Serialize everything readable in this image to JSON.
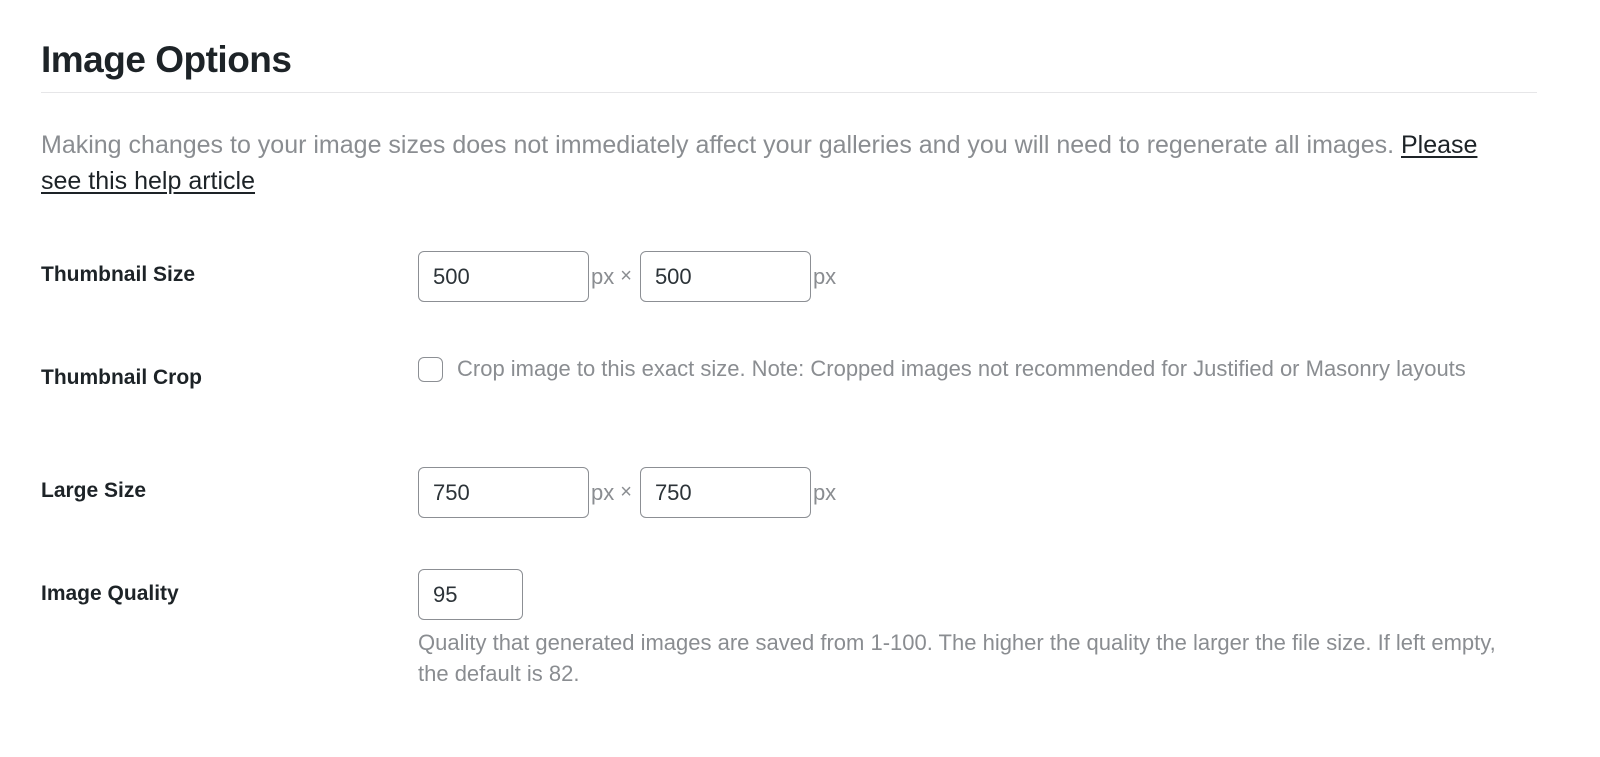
{
  "section": {
    "title": "Image Options",
    "intro_text": "Making changes to your image sizes does not immediately affect your galleries and you will need to regenerate all images. ",
    "help_link_label": "Please see this help article"
  },
  "fields": {
    "thumbnail_size": {
      "label": "Thumbnail Size",
      "width_value": "500",
      "height_value": "500",
      "unit": "px",
      "separator": "×"
    },
    "thumbnail_crop": {
      "label": "Thumbnail Crop",
      "checked": false,
      "description": "Crop image to this exact size. Note: Cropped images not recommended for Justified or Masonry layouts"
    },
    "large_size": {
      "label": "Large Size",
      "width_value": "750",
      "height_value": "750",
      "unit": "px",
      "separator": "×"
    },
    "image_quality": {
      "label": "Image Quality",
      "value": "95",
      "description": "Quality that generated images are saved from 1-100. The higher the quality the larger the file size. If left empty, the default is 82."
    }
  }
}
